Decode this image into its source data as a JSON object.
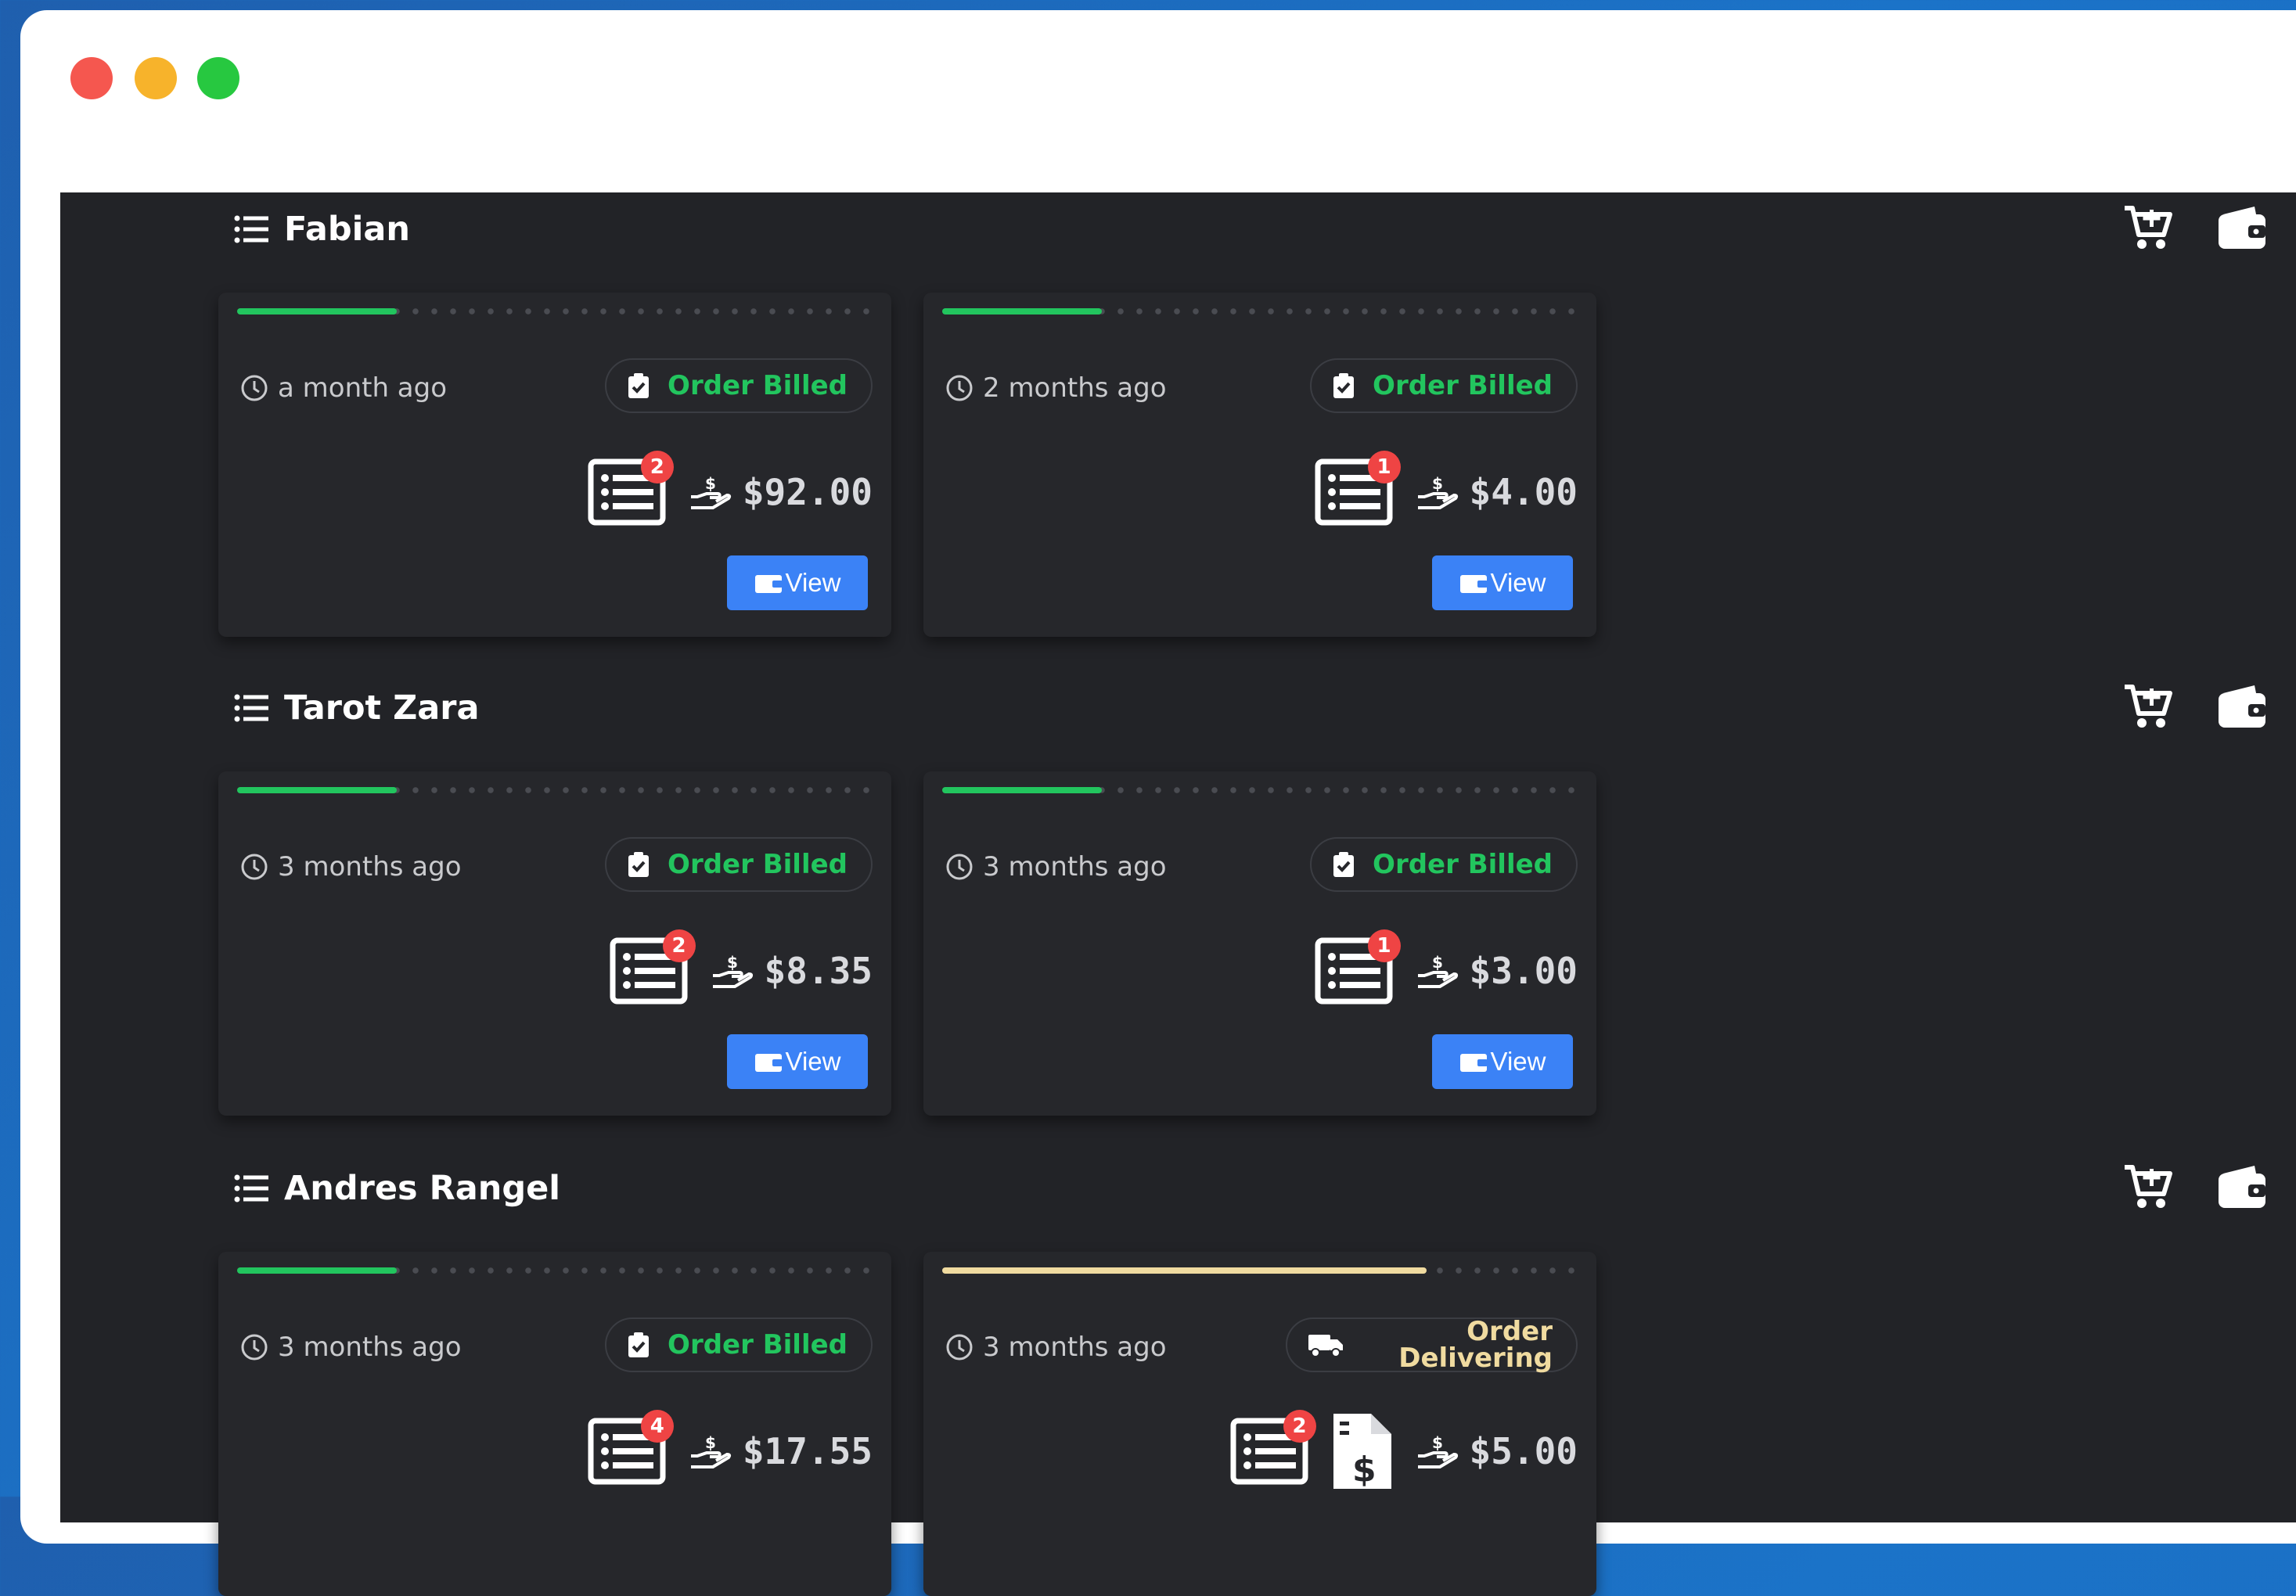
{
  "window": {
    "controls": [
      "close",
      "minimize",
      "zoom"
    ]
  },
  "colors": {
    "billed": "#22c55e",
    "delivering": "#f0dba0",
    "badge": "#ef4444",
    "view_button": "#3b82f6",
    "panel": "#222327"
  },
  "customers": [
    {
      "name": "Fabian",
      "actions": [
        "cart-plus-icon",
        "wallet-icon"
      ],
      "orders": [
        {
          "time": "a month ago",
          "status": "Order Billed",
          "progress": 0.25,
          "items": "2",
          "amount": "$92.00",
          "view_label": "View"
        },
        {
          "time": "2 months ago",
          "status": "Order Billed",
          "progress": 0.25,
          "items": "1",
          "amount": "$4.00",
          "view_label": "View"
        }
      ]
    },
    {
      "name": "Tarot Zara",
      "actions": [
        "cart-plus-icon",
        "wallet-icon"
      ],
      "orders": [
        {
          "time": "3 months ago",
          "status": "Order Billed",
          "progress": 0.25,
          "items": "2",
          "amount": "$8.35",
          "view_label": "View"
        },
        {
          "time": "3 months ago",
          "status": "Order Billed",
          "progress": 0.25,
          "items": "1",
          "amount": "$3.00",
          "view_label": "View"
        }
      ]
    },
    {
      "name": "Andres Rangel",
      "actions": [
        "cart-plus-icon",
        "wallet-icon"
      ],
      "orders": [
        {
          "time": "3 months ago",
          "status": "Order Billed",
          "progress": 0.25,
          "items": "4",
          "amount": "$17.55"
        },
        {
          "time": "3 months ago",
          "status_line1": "Order",
          "status_line2": "Delivering",
          "progress": 0.76,
          "items": "2",
          "amount": "$5.00",
          "has_invoice": true
        }
      ]
    }
  ]
}
